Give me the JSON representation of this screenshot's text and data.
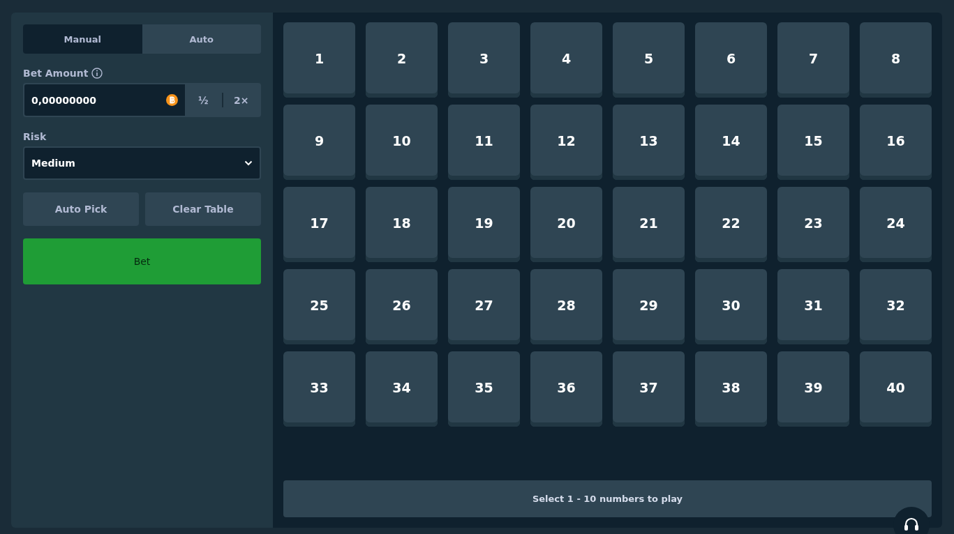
{
  "mode_tabs": [
    {
      "label": "Manual",
      "selected": true
    },
    {
      "label": "Auto",
      "selected": false
    }
  ],
  "bet_amount": {
    "label": "Bet Amount",
    "value": "0,00000000",
    "half_button": "½",
    "double_button": "2×"
  },
  "risk": {
    "label": "Risk",
    "value": "Medium"
  },
  "actions": [
    "Auto Pick",
    "Clear Table"
  ],
  "bet_button": "Bet",
  "tiles": [
    {
      "label": "1",
      "selected": false
    },
    {
      "label": "2",
      "selected": false
    },
    {
      "label": "3",
      "selected": false
    },
    {
      "label": "4",
      "selected": false
    },
    {
      "label": "5",
      "selected": false
    },
    {
      "label": "6",
      "selected": false
    },
    {
      "label": "7",
      "selected": false
    },
    {
      "label": "8",
      "selected": false
    },
    {
      "label": "9",
      "selected": false
    },
    {
      "label": "10",
      "selected": false
    },
    {
      "label": "11",
      "selected": false
    },
    {
      "label": "12",
      "selected": false
    },
    {
      "label": "13",
      "selected": false
    },
    {
      "label": "14",
      "selected": false
    },
    {
      "label": "15",
      "selected": false
    },
    {
      "label": "16",
      "selected": false
    },
    {
      "label": "17",
      "selected": false
    },
    {
      "label": "18",
      "selected": false
    },
    {
      "label": "19",
      "selected": false
    },
    {
      "label": "20",
      "selected": false
    },
    {
      "label": "21",
      "selected": false
    },
    {
      "label": "22",
      "selected": false
    },
    {
      "label": "23",
      "selected": false
    },
    {
      "label": "24",
      "selected": false
    },
    {
      "label": "25",
      "selected": false
    },
    {
      "label": "26",
      "selected": false
    },
    {
      "label": "27",
      "selected": false
    },
    {
      "label": "28",
      "selected": false
    },
    {
      "label": "29",
      "selected": false
    },
    {
      "label": "30",
      "selected": false
    },
    {
      "label": "31",
      "selected": false
    },
    {
      "label": "32",
      "selected": false
    },
    {
      "label": "33",
      "selected": false
    },
    {
      "label": "34",
      "selected": false
    },
    {
      "label": "35",
      "selected": false
    },
    {
      "label": "36",
      "selected": false
    },
    {
      "label": "37",
      "selected": false
    },
    {
      "label": "38",
      "selected": false
    },
    {
      "label": "39",
      "selected": false
    },
    {
      "label": "40",
      "selected": false
    }
  ],
  "footer_message": "Select 1 - 10 numbers to play"
}
